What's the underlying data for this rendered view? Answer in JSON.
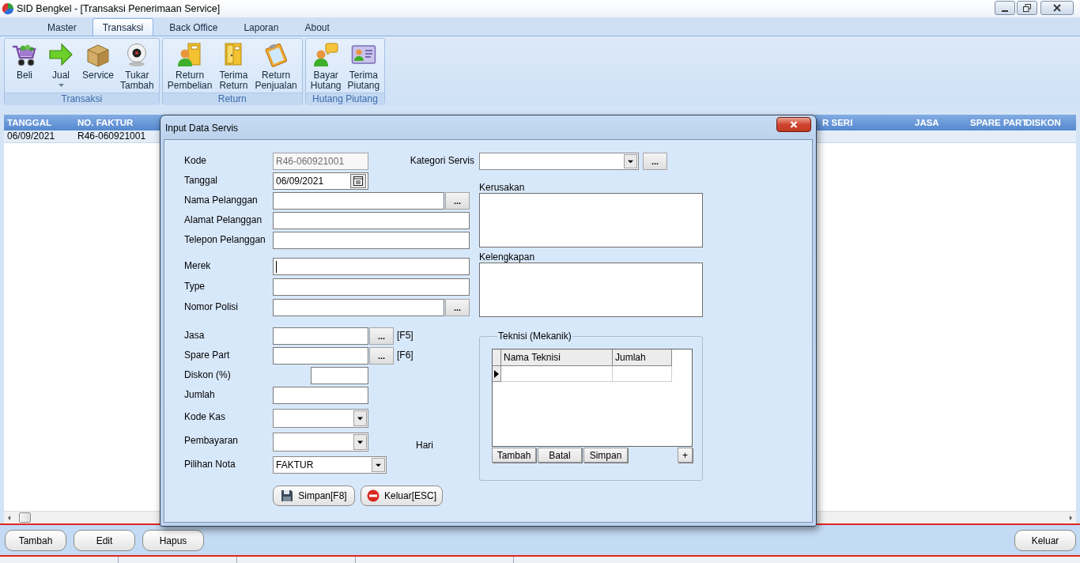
{
  "window": {
    "title": "SID Bengkel - [Transaksi Penerimaan Service]"
  },
  "ribbon": {
    "tabs": [
      {
        "label": "Master",
        "selected": false
      },
      {
        "label": "Transaksi",
        "selected": true
      },
      {
        "label": "Back Office",
        "selected": false
      },
      {
        "label": "Laporan",
        "selected": false
      },
      {
        "label": "About",
        "selected": false
      }
    ],
    "groups": [
      {
        "title": "Transaksi",
        "items": [
          {
            "label": "Beli",
            "dropdown": false
          },
          {
            "label": "Jual",
            "dropdown": true
          },
          {
            "label": "Service",
            "dropdown": false
          },
          {
            "label": "Tukar Tambah",
            "dropdown": false
          }
        ]
      },
      {
        "title": "Return",
        "items": [
          {
            "label": "Return Pembelian",
            "dropdown": false
          },
          {
            "label": "Terima Return",
            "dropdown": false
          },
          {
            "label": "Return Penjualan",
            "dropdown": false
          }
        ]
      },
      {
        "title": "Hutang Piutang",
        "items": [
          {
            "label": "Bayar Hutang",
            "dropdown": false
          },
          {
            "label": "Terima Piutang",
            "dropdown": false
          }
        ]
      }
    ]
  },
  "table": {
    "columns": [
      "TANGGAL",
      "NO. FAKTUR",
      "R SERI",
      "JASA",
      "SPARE PART",
      "DISKON"
    ],
    "rows": [
      [
        "06/09/2021",
        "R46-060921001"
      ]
    ]
  },
  "dialog": {
    "title": "Input Data Servis",
    "sections": [
      {
        "fields": [
          {
            "label": "Kode",
            "kind": "short",
            "value": "R46-060921001",
            "disabled": true,
            "focused": false
          },
          {
            "label": "Tanggal",
            "kind": "date",
            "value": "06/09/2021",
            "disabled": false,
            "focused": false
          },
          {
            "label": "Nama Pelanggan",
            "kind": "long_lookup",
            "button": "...",
            "disabled": false,
            "focused": false
          },
          {
            "label": "Alamat Pelanggan",
            "kind": "long",
            "disabled": false,
            "focused": false
          },
          {
            "label": "Telepon Pelanggan",
            "kind": "long",
            "disabled": false,
            "focused": false
          }
        ]
      },
      {
        "fields": [
          {
            "label": "Merek",
            "kind": "long",
            "disabled": false,
            "focused": true
          },
          {
            "label": "Type",
            "kind": "long",
            "disabled": false,
            "focused": false
          },
          {
            "label": "Nomor Polisi",
            "kind": "long_lookup",
            "button": "...",
            "disabled": false,
            "focused": false
          }
        ]
      },
      {
        "fields": [
          {
            "label": "Jasa",
            "kind": "short_lookup",
            "button": "...",
            "hotkey": "[F5]",
            "disabled": false,
            "focused": false
          },
          {
            "label": "Spare Part",
            "kind": "short_lookup",
            "button": "...",
            "hotkey": "[F6]",
            "disabled": false,
            "focused": false
          },
          {
            "label": "Diskon (%)",
            "kind": "narrow",
            "disabled": false,
            "focused": false
          },
          {
            "label": "Jumlah",
            "kind": "short",
            "disabled": false,
            "focused": false
          }
        ]
      },
      {
        "fields": [
          {
            "label": "Kode Kas",
            "kind": "combo",
            "disabled": false,
            "focused": false
          },
          {
            "label": "Pembayaran",
            "kind": "combo",
            "suffix": "Hari",
            "disabled": false,
            "focused": false
          },
          {
            "label": "Pilihan Nota",
            "kind": "wide_combo",
            "value": "FAKTUR",
            "disabled": false,
            "focused": false
          }
        ]
      }
    ],
    "category": {
      "label": "Kategori Servis",
      "button": "..."
    },
    "notes": [
      {
        "label": "Kerusakan"
      },
      {
        "label": "Kelengkapan"
      }
    ],
    "technicians": {
      "title": "Teknisi (Mekanik)",
      "columns": [
        "Nama Teknisi",
        "Jumlah"
      ],
      "rows": [
        {
          "selected": true
        }
      ],
      "buttons": [
        "Tambah",
        "Batal",
        "Simpan"
      ],
      "add_button": "+"
    },
    "buttons": [
      {
        "label": "Simpan[F8]",
        "kind": "save"
      },
      {
        "label": "Keluar[ESC]",
        "kind": "exit"
      }
    ]
  },
  "actions": {
    "left": [
      "Tambah",
      "Edit",
      "Hapus"
    ],
    "right": [
      "Keluar"
    ]
  }
}
